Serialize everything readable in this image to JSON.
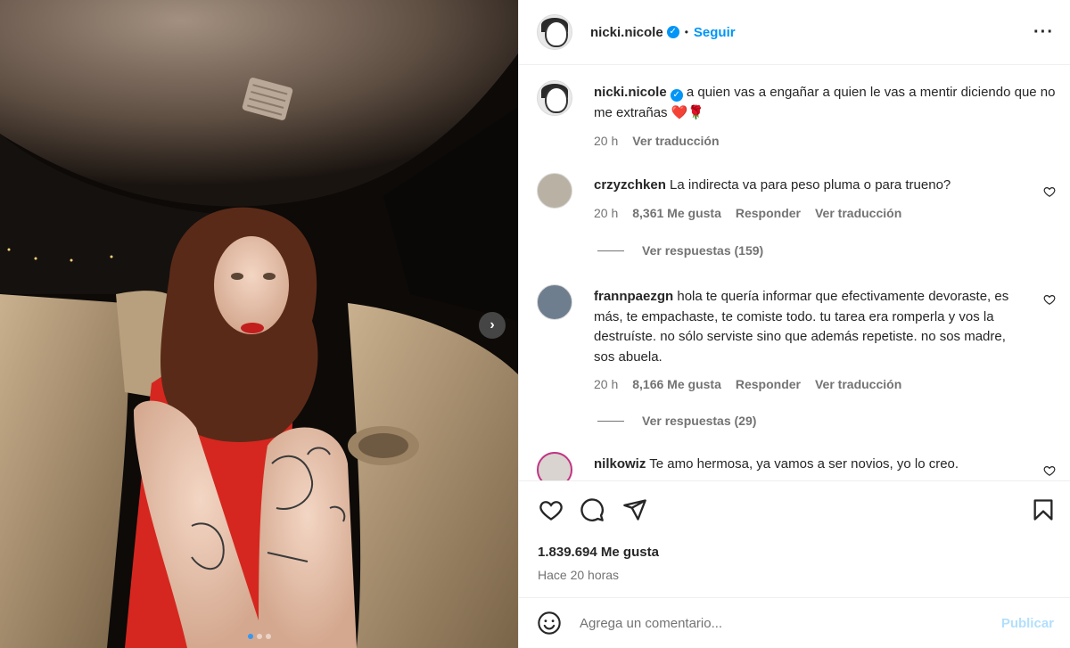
{
  "post_author": {
    "username": "nicki.nicole",
    "separator": "•",
    "follow_label": "Seguir",
    "more_icon": "more-horizontal-icon"
  },
  "caption": {
    "username": "nicki.nicole",
    "text": "a quien vas a engañar a quien le vas a mentir diciendo que no me extrañas ❤️🌹",
    "time": "20 h",
    "translate_label": "Ver traducción"
  },
  "comments": [
    {
      "username": "crzyzchken",
      "text": "La indirecta va para peso pluma o para trueno?",
      "time": "20 h",
      "likes": "8,361 Me gusta",
      "reply_label": "Responder",
      "translate_label": "Ver traducción",
      "replies_label": "Ver respuestas (159)"
    },
    {
      "username": "frannpaezgn",
      "text": "hola te quería informar que efectivamente devoraste, es más, te empachaste, te comiste todo. tu tarea era romperla y vos la destruíste. no sólo serviste sino que además repetiste. no sos madre, sos abuela.",
      "time": "20 h",
      "likes": "8,166 Me gusta",
      "reply_label": "Responder",
      "translate_label": "Ver traducción",
      "replies_label": "Ver respuestas (29)"
    },
    {
      "username": "nilkowiz",
      "text": "Te amo hermosa, ya vamos a ser novios, yo lo creo."
    }
  ],
  "actions": {
    "like_icon": "heart-icon",
    "comment_icon": "comment-icon",
    "share_icon": "paper-plane-icon",
    "save_icon": "bookmark-icon"
  },
  "likes_count": "1.839.694 Me gusta",
  "posted_time": "Hace 20 horas",
  "add_comment": {
    "placeholder": "Agrega un comentario...",
    "post_label": "Publicar",
    "emoji_icon": "emoji-icon"
  },
  "carousel": {
    "next_icon": "chevron-right-icon",
    "slide_count": 3,
    "active_slide": 1
  },
  "colors": {
    "link_blue": "#0095f6",
    "verified_blue": "#0095f6",
    "muted_text": "#737373",
    "publish_disabled": "#b2dffc"
  }
}
